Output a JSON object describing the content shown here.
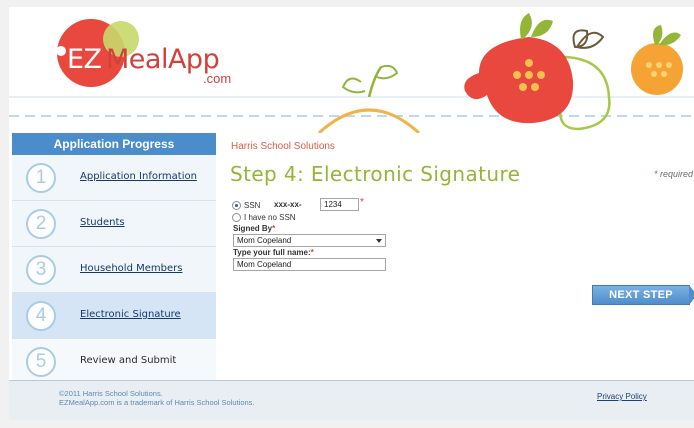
{
  "logo": {
    "brand_ez": "EZ",
    "brand_meal": "MealApp",
    "brand_com": ".com"
  },
  "sidebar": {
    "title": "Application Progress",
    "steps": [
      {
        "num": "1",
        "label": "Application Information"
      },
      {
        "num": "2",
        "label": "Students"
      },
      {
        "num": "3",
        "label": "Household Members"
      },
      {
        "num": "4",
        "label": "Electronic Signature"
      },
      {
        "num": "5",
        "label": "Review and Submit"
      }
    ],
    "active_step": 4
  },
  "main": {
    "org_name": "Harris School Solutions",
    "step_title": "Step 4: Electronic Signature",
    "required_note": "required",
    "ssn": {
      "option_label": "SSN",
      "prefix": "xxx-xx-",
      "value": "1234",
      "no_ssn_label": "I have no SSN"
    },
    "signed_by": {
      "label": "Signed By",
      "value": "Mom Copeland"
    },
    "full_name": {
      "label": "Type your full name:",
      "value": "Mom Copeland"
    },
    "next_button": "NEXT STEP"
  },
  "footer": {
    "copyright_line1": "©2011 Harris School Solutions.",
    "copyright_line2": "EZMealApp.com is a trademark of Harris School Solutions.",
    "privacy_link": "Privacy Policy"
  },
  "colors": {
    "accent_blue": "#4b8ccb",
    "title_green": "#93b637",
    "brand_red": "#d2403c"
  }
}
